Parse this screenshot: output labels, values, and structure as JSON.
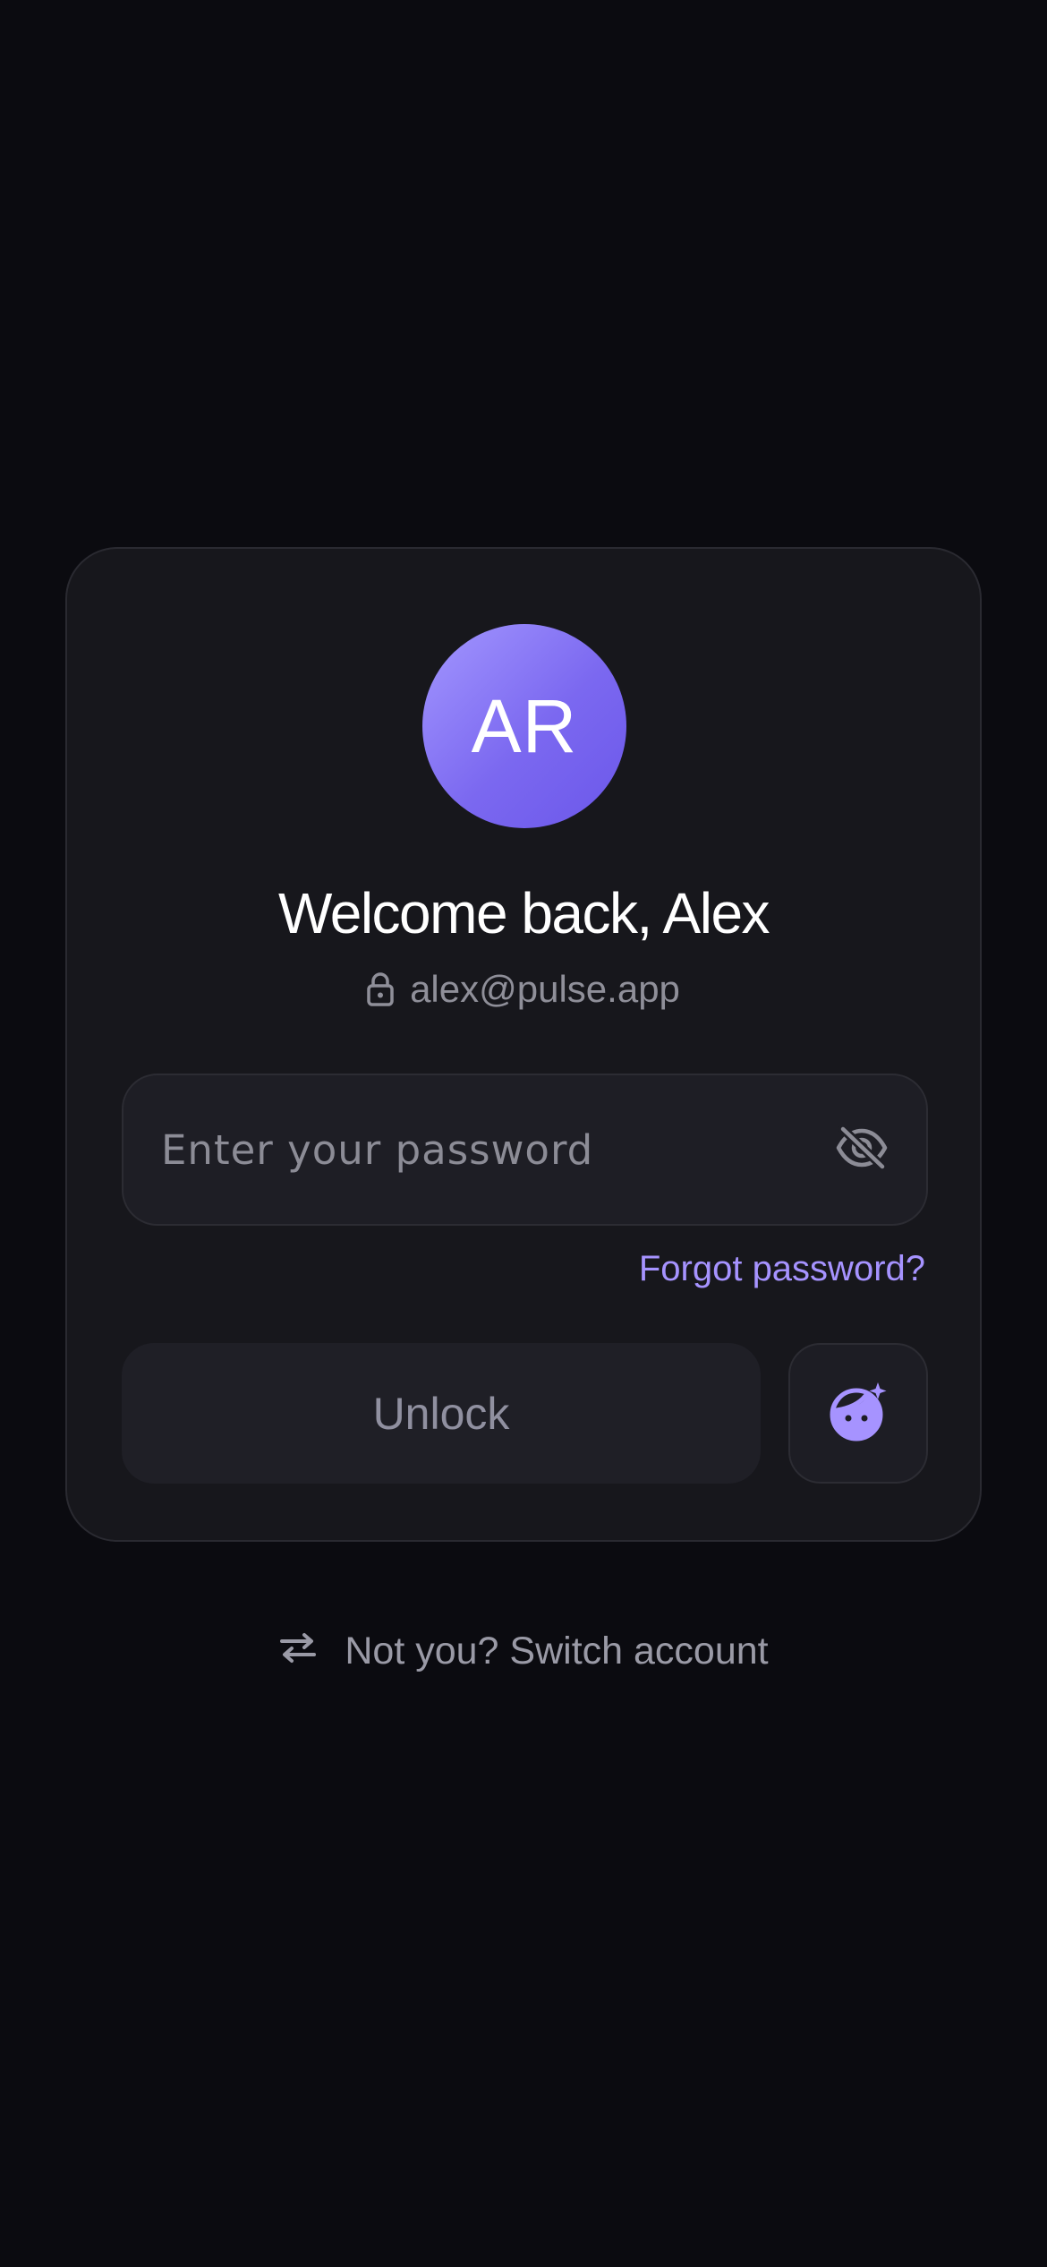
{
  "profile": {
    "initials": "AR",
    "welcome": "Welcome back, Alex",
    "email": "alex@pulse.app"
  },
  "password": {
    "placeholder": "Enter your password",
    "value": ""
  },
  "links": {
    "forgot": "Forgot password?",
    "switch_account": "Not you? Switch account"
  },
  "actions": {
    "unlock": "Unlock"
  },
  "icons": {
    "email_lock": "lock-icon",
    "password_toggle": "eye-off-icon",
    "face_unlock": "face-id-icon",
    "switch": "swap-arrows-icon"
  },
  "colors": {
    "background": "#0b0b10",
    "card": "#17171c",
    "accent": "#a693ff",
    "avatar_gradient_start": "#a397ff",
    "avatar_gradient_end": "#6b57ea"
  }
}
